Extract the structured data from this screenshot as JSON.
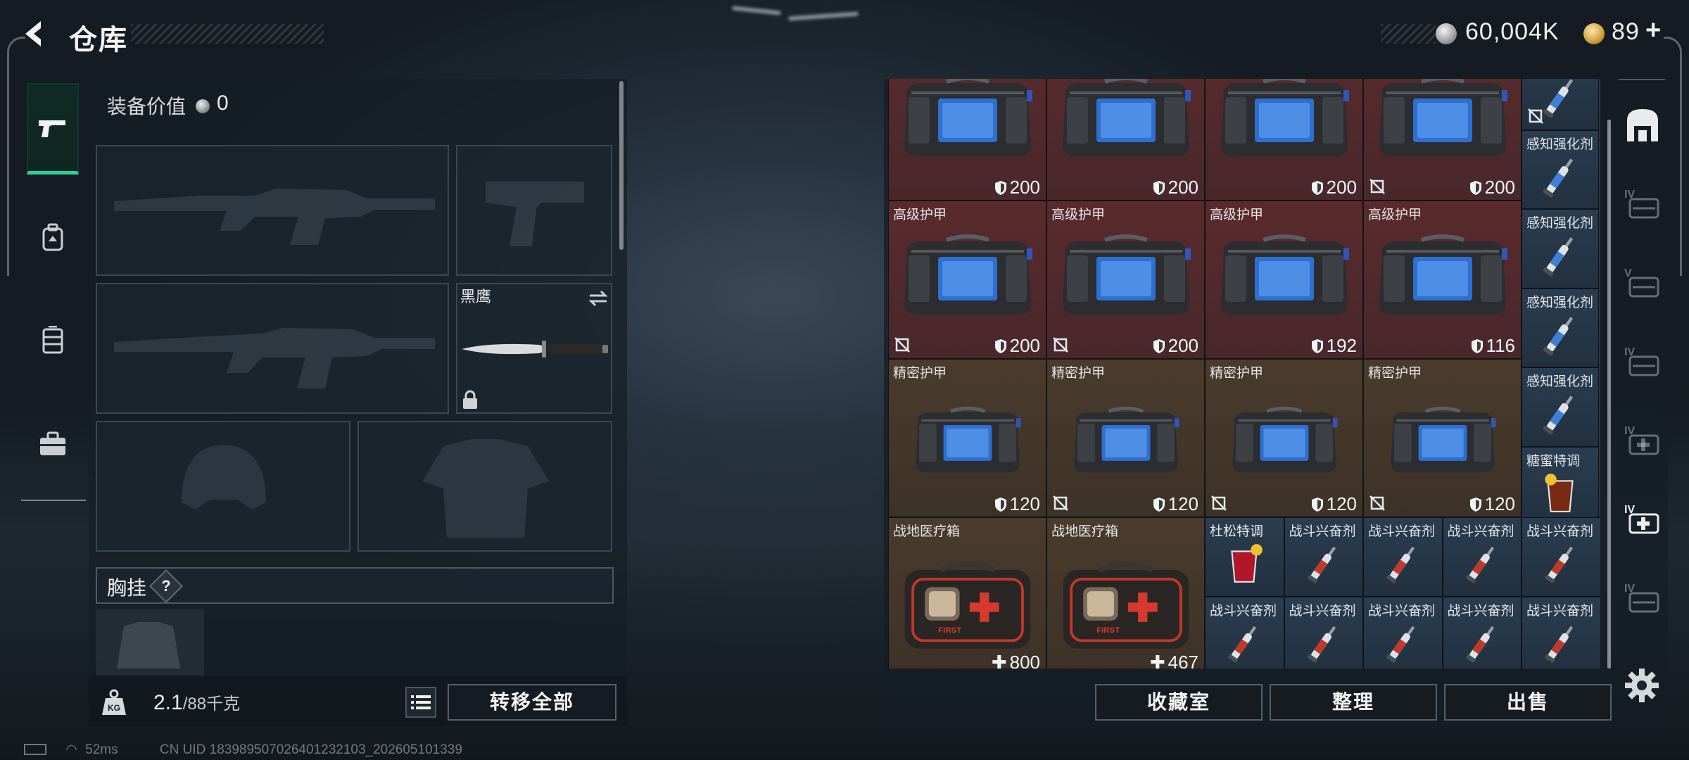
{
  "header": {
    "title": "仓库",
    "currency_silver": "60,004K",
    "currency_gold": "89",
    "currency_gold_plus": "+"
  },
  "loadout": {
    "equipment_value_label": "装备价值",
    "equipment_value": "0",
    "melee_name": "黑鹰",
    "chest_rig_label": "胸挂",
    "help_mark": "?",
    "weight_value": "2.1",
    "weight_max": "/88千克",
    "transfer_all_label": "转移全部"
  },
  "storage": {
    "rows": [
      [
        {
          "name": "",
          "value": "200",
          "stat": "armor",
          "tint": "red",
          "item": "armor-bag",
          "uninsured": false
        },
        {
          "name": "",
          "value": "200",
          "stat": "armor",
          "tint": "red",
          "item": "armor-bag",
          "uninsured": false
        },
        {
          "name": "",
          "value": "200",
          "stat": "armor",
          "tint": "red",
          "item": "armor-bag",
          "uninsured": false
        },
        {
          "name": "",
          "value": "200",
          "stat": "armor",
          "tint": "red",
          "item": "armor-bag",
          "uninsured": true
        }
      ],
      [
        {
          "name": "高级护甲",
          "value": "200",
          "stat": "armor",
          "tint": "red",
          "item": "armor-bag",
          "uninsured": true
        },
        {
          "name": "高级护甲",
          "value": "200",
          "stat": "armor",
          "tint": "red",
          "item": "armor-bag",
          "uninsured": true
        },
        {
          "name": "高级护甲",
          "value": "192",
          "stat": "armor",
          "tint": "red",
          "item": "armor-bag",
          "uninsured": false
        },
        {
          "name": "高级护甲",
          "value": "116",
          "stat": "armor",
          "tint": "red",
          "item": "armor-bag",
          "uninsured": false
        }
      ],
      [
        {
          "name": "精密护甲",
          "value": "120",
          "stat": "armor",
          "tint": "brown",
          "item": "armor-bag-small",
          "uninsured": false
        },
        {
          "name": "精密护甲",
          "value": "120",
          "stat": "armor",
          "tint": "brown",
          "item": "armor-bag-small",
          "uninsured": true
        },
        {
          "name": "精密护甲",
          "value": "120",
          "stat": "armor",
          "tint": "brown",
          "item": "armor-bag-small",
          "uninsured": true
        },
        {
          "name": "精密护甲",
          "value": "120",
          "stat": "armor",
          "tint": "brown",
          "item": "armor-bag-small",
          "uninsured": true
        }
      ],
      [
        {
          "name": "战地医疗箱",
          "value": "800",
          "stat": "heal",
          "tint": "brown",
          "item": "first-aid-kit",
          "uninsured": false
        },
        {
          "name": "战地医疗箱",
          "value": "467",
          "stat": "heal",
          "tint": "brown",
          "item": "first-aid-kit",
          "uninsured": false
        }
      ]
    ],
    "side_column": [
      {
        "name": "",
        "item": "syringe",
        "uninsured": true
      },
      {
        "name": "感知强化剂",
        "item": "syringe"
      },
      {
        "name": "感知强化剂",
        "item": "syringe"
      },
      {
        "name": "感知强化剂",
        "item": "syringe"
      },
      {
        "name": "感知强化剂",
        "item": "syringe"
      },
      {
        "name": "糖蜜特调",
        "item": "drink-glass"
      }
    ],
    "small_grid": [
      [
        {
          "name": "杜松特调",
          "item": "red-drink"
        },
        {
          "name": "战斗兴奋剂",
          "item": "red-syringe"
        },
        {
          "name": "战斗兴奋剂",
          "item": "red-syringe"
        },
        {
          "name": "战斗兴奋剂",
          "item": "red-syringe"
        },
        {
          "name": "战斗兴奋剂",
          "item": "red-syringe"
        }
      ],
      [
        {
          "name": "战斗兴奋剂",
          "item": "red-syringe"
        },
        {
          "name": "战斗兴奋剂",
          "item": "red-syringe"
        },
        {
          "name": "战斗兴奋剂",
          "item": "red-syringe"
        },
        {
          "name": "战斗兴奋剂",
          "item": "red-syringe"
        },
        {
          "name": "战斗兴奋剂",
          "item": "red-syringe"
        }
      ]
    ],
    "buttons": {
      "collection": "收藏室",
      "sort": "整理",
      "sell": "出售"
    }
  },
  "right_rail": {
    "icons": [
      "safehouse-icon",
      "tier-iv-armor-icon",
      "tier-v-gear-icon",
      "tier-iv-container-icon",
      "tier-iv-medkit-icon",
      "tier-iv-medkit-active-icon",
      "tier-iv-misc-icon"
    ],
    "tier_labels": [
      "",
      "IV",
      "V",
      "IV",
      "IV",
      "IV",
      "IV"
    ]
  },
  "status_bar": {
    "ping": "52ms",
    "uid": "CN UID 183989507026401232103_202605101339"
  },
  "colors": {
    "accent_green": "#2bd39a",
    "red_tier": "#5a2a2c",
    "brown_tier": "#4a3b2c",
    "blue_tier": "#2b3d50"
  }
}
